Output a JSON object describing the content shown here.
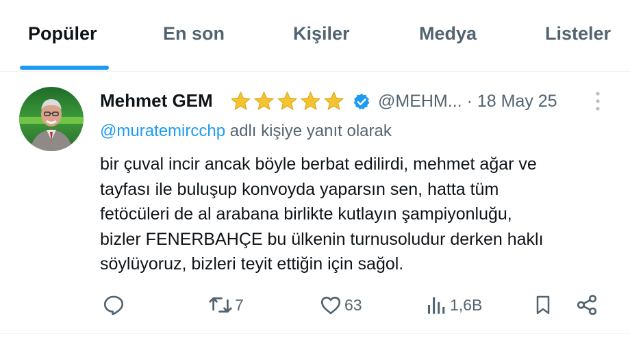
{
  "tabs": [
    {
      "label": "Popüler",
      "active": true
    },
    {
      "label": "En son",
      "active": false
    },
    {
      "label": "Kişiler",
      "active": false
    },
    {
      "label": "Medya",
      "active": false
    },
    {
      "label": "Listeler",
      "active": false
    }
  ],
  "tweet": {
    "author_name": "Mehmet GEM",
    "star_count": 5,
    "verified": true,
    "handle": "@MEHM...",
    "date": "· 18 May 25",
    "reply_to": {
      "mention": "@muratemircchp",
      "suffix": " adlı kişiye yanıt olarak"
    },
    "body_lines": [
      "bir çuval incir ancak böyle berbat edilirdi, mehmet ağar ve",
      "tayfası ile buluşup konvoyda yaparsın sen, hatta tüm",
      "fetöcüleri de al arabana birlikte kutlayın şampiyonluğu,",
      "bizler FENERBAHÇE bu ülkenin turnusoludur derken haklı",
      "söylüyoruz, bizleri teyit ettiğin için sağol."
    ],
    "actions": {
      "reply_count": "",
      "retweet_count": "7",
      "like_count": "63",
      "views_count": "1,6B"
    }
  },
  "colors": {
    "accent": "#1d9bf0",
    "text_primary": "#0f1419",
    "text_secondary": "#536471",
    "star": "#f4c430",
    "divider": "#eff3f4"
  },
  "icons": [
    "reply-icon",
    "retweet-icon",
    "like-icon",
    "views-icon",
    "bookmark-icon",
    "share-icon",
    "more-icon",
    "verified-badge-icon",
    "star-icon"
  ]
}
